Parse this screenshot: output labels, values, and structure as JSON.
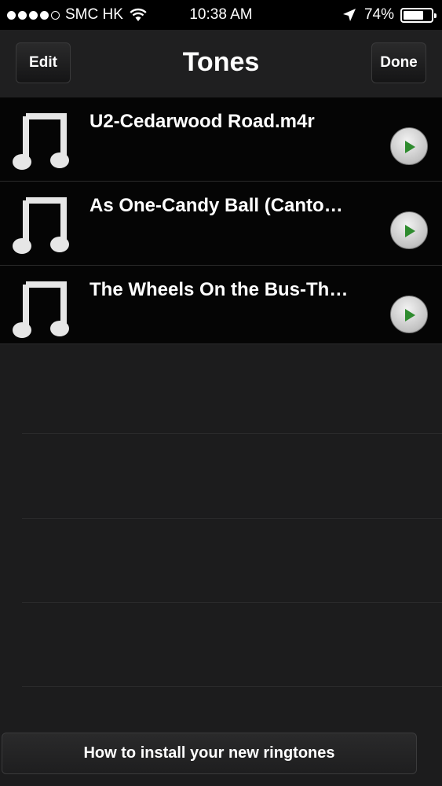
{
  "status_bar": {
    "carrier": "SMC HK",
    "time": "10:38 AM",
    "battery_percent": "74%",
    "battery_level": 0.74
  },
  "nav": {
    "edit_label": "Edit",
    "title": "Tones",
    "done_label": "Done"
  },
  "tones": [
    {
      "name": "U2-Cedarwood Road.m4r",
      "icon": "music-note-icon",
      "play_icon": "play-icon"
    },
    {
      "name": "As One-Candy Ball (Canto…",
      "icon": "music-note-icon",
      "play_icon": "play-icon"
    },
    {
      "name": "The Wheels On the Bus-Th…",
      "icon": "music-note-icon",
      "play_icon": "play-icon"
    }
  ],
  "footer": {
    "install_label": "How to install your new ringtones"
  },
  "colors": {
    "play_triangle": "#2e8b2e",
    "background": "#1c1c1d"
  }
}
